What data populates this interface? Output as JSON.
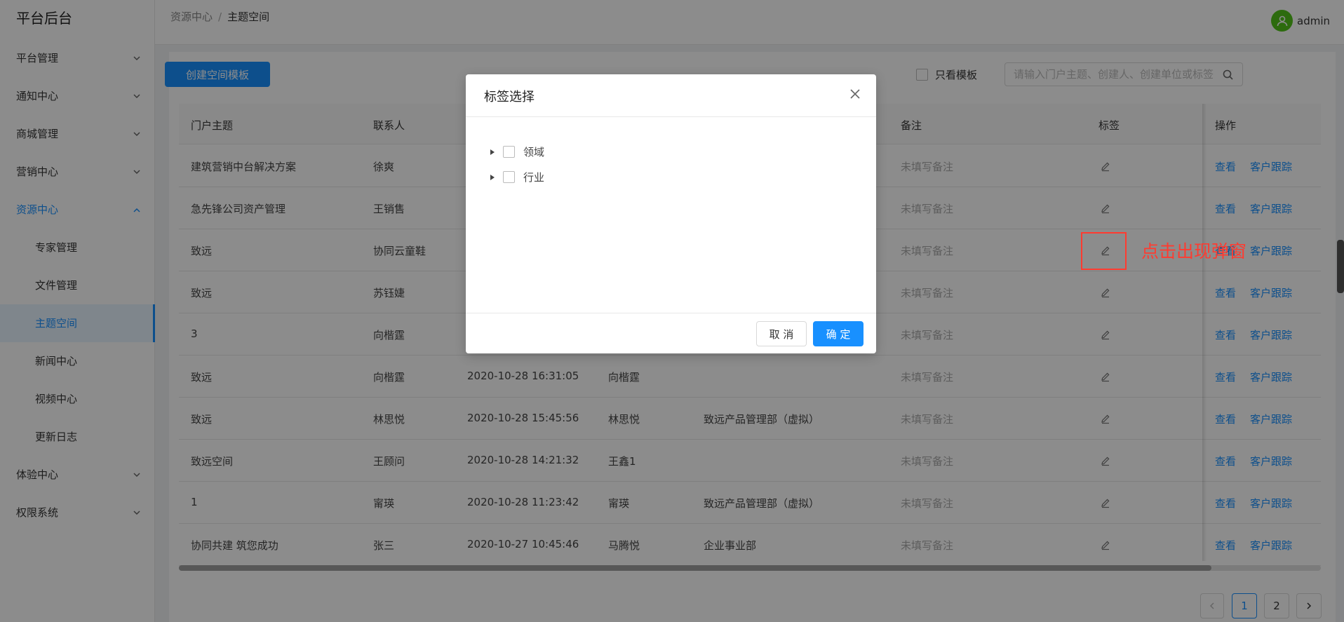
{
  "app": {
    "brand": "平台后台"
  },
  "sidebar": {
    "items": [
      {
        "label": "平台管理",
        "type": "group"
      },
      {
        "label": "通知中心",
        "type": "group"
      },
      {
        "label": "商城管理",
        "type": "group"
      },
      {
        "label": "营销中心",
        "type": "group"
      },
      {
        "label": "资源中心",
        "type": "group-open"
      },
      {
        "label": "专家管理",
        "type": "sub"
      },
      {
        "label": "文件管理",
        "type": "sub"
      },
      {
        "label": "主题空间",
        "type": "sub-active"
      },
      {
        "label": "新闻中心",
        "type": "sub"
      },
      {
        "label": "视频中心",
        "type": "sub"
      },
      {
        "label": "更新日志",
        "type": "sub"
      },
      {
        "label": "体验中心",
        "type": "group"
      },
      {
        "label": "权限系统",
        "type": "group"
      }
    ]
  },
  "header": {
    "breadcrumb": [
      "资源中心",
      "主题空间"
    ],
    "breadcrumb_sep": "/",
    "username": "admin"
  },
  "toolbar": {
    "create_label": "创建空间模板",
    "only_template_label": "只看模板",
    "search_placeholder": "请输入门户主题、创建人、创建单位或标签"
  },
  "table": {
    "columns": [
      "门户主题",
      "联系人",
      "",
      "",
      "",
      "备注",
      "标签",
      "操作"
    ],
    "view_label": "查看",
    "track_label": "客户跟踪",
    "edit_label": "编辑",
    "rows": [
      {
        "topic": "建筑营销中台解决方案",
        "contact": "徐爽",
        "time": "",
        "creator": "",
        "org": "",
        "note": "未填写备注"
      },
      {
        "topic": "急先锋公司资产管理",
        "contact": "王销售",
        "time": "",
        "creator": "",
        "org": "",
        "note": "未填写备注"
      },
      {
        "topic": "致远",
        "contact": "协同云童鞋",
        "time": "",
        "creator": "",
        "org": "",
        "note": "未填写备注"
      },
      {
        "topic": "致远",
        "contact": "苏钰婕",
        "time": "",
        "creator": "",
        "org": "",
        "note": "未填写备注"
      },
      {
        "topic": "3",
        "contact": "向楷霆",
        "time": "",
        "creator": "",
        "org": "",
        "note": "未填写备注"
      },
      {
        "topic": "致远",
        "contact": "向楷霆",
        "time": "2020-10-28 16:31:05",
        "creator": "向楷霆",
        "org": "",
        "note": "未填写备注"
      },
      {
        "topic": "致远",
        "contact": "林思悦",
        "time": "2020-10-28 15:45:56",
        "creator": "林思悦",
        "org": "致远产品管理部（虚拟）",
        "note": "未填写备注"
      },
      {
        "topic": "致远空间",
        "contact": "王顾问",
        "time": "2020-10-28 14:21:32",
        "creator": "王鑫1",
        "org": "",
        "note": "未填写备注"
      },
      {
        "topic": "1",
        "contact": "甯瑛",
        "time": "2020-10-28 11:23:42",
        "creator": "甯瑛",
        "org": "致远产品管理部（虚拟）",
        "note": "未填写备注"
      },
      {
        "topic": "协同共建 筑您成功",
        "contact": "张三",
        "time": "2020-10-27 10:45:46",
        "creator": "马腾悦",
        "org": "企业事业部",
        "note": "未填写备注"
      }
    ]
  },
  "pagination": {
    "pages": [
      "1",
      "2"
    ],
    "current": "1"
  },
  "annotation": {
    "text": "点击出现弹窗"
  },
  "modal": {
    "title": "标签选择",
    "tree": [
      {
        "label": "领域"
      },
      {
        "label": "行业"
      }
    ],
    "cancel_label": "取 消",
    "ok_label": "确 定"
  },
  "colors": {
    "primary": "#1890ff",
    "annotation": "#ff3b30",
    "avatar": "#52c41a"
  }
}
